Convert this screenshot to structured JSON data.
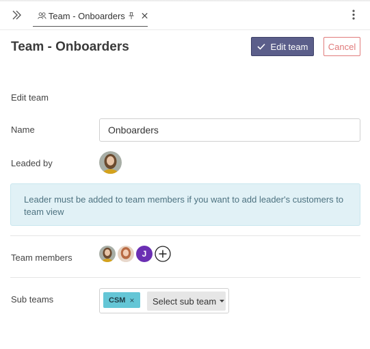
{
  "tab": {
    "title": "Team - Onboarders",
    "icons": {
      "team": "team-icon",
      "pin": "pin-icon",
      "close": "close-icon"
    }
  },
  "toolbar": {
    "expand_icon": "double-chevron-right-icon",
    "menu_icon": "kebab-menu-icon"
  },
  "header": {
    "title": "Team - Onboarders",
    "edit_label": "Edit team",
    "cancel_label": "Cancel"
  },
  "form": {
    "section_title": "Edit team",
    "name_label": "Name",
    "name_value": "Onboarders",
    "leaded_by_label": "Leaded by",
    "info_text": "Leader must be added to team members if you want to add leader's customers to team view",
    "team_members_label": "Team members",
    "members": [
      {
        "type": "photo"
      },
      {
        "type": "photo"
      },
      {
        "type": "initial",
        "initial": "J",
        "color": "#6b2fb3"
      }
    ],
    "sub_teams_label": "Sub teams",
    "sub_teams": [
      {
        "label": "CSM",
        "remove": "×"
      }
    ],
    "select_sub_team_label": "Select sub team"
  },
  "colors": {
    "primary_button": "#5b5e8a",
    "cancel": "#e07a7a",
    "info_bg": "#e1f1f6",
    "info_text": "#4d7280",
    "chip": "#64c6d6"
  }
}
